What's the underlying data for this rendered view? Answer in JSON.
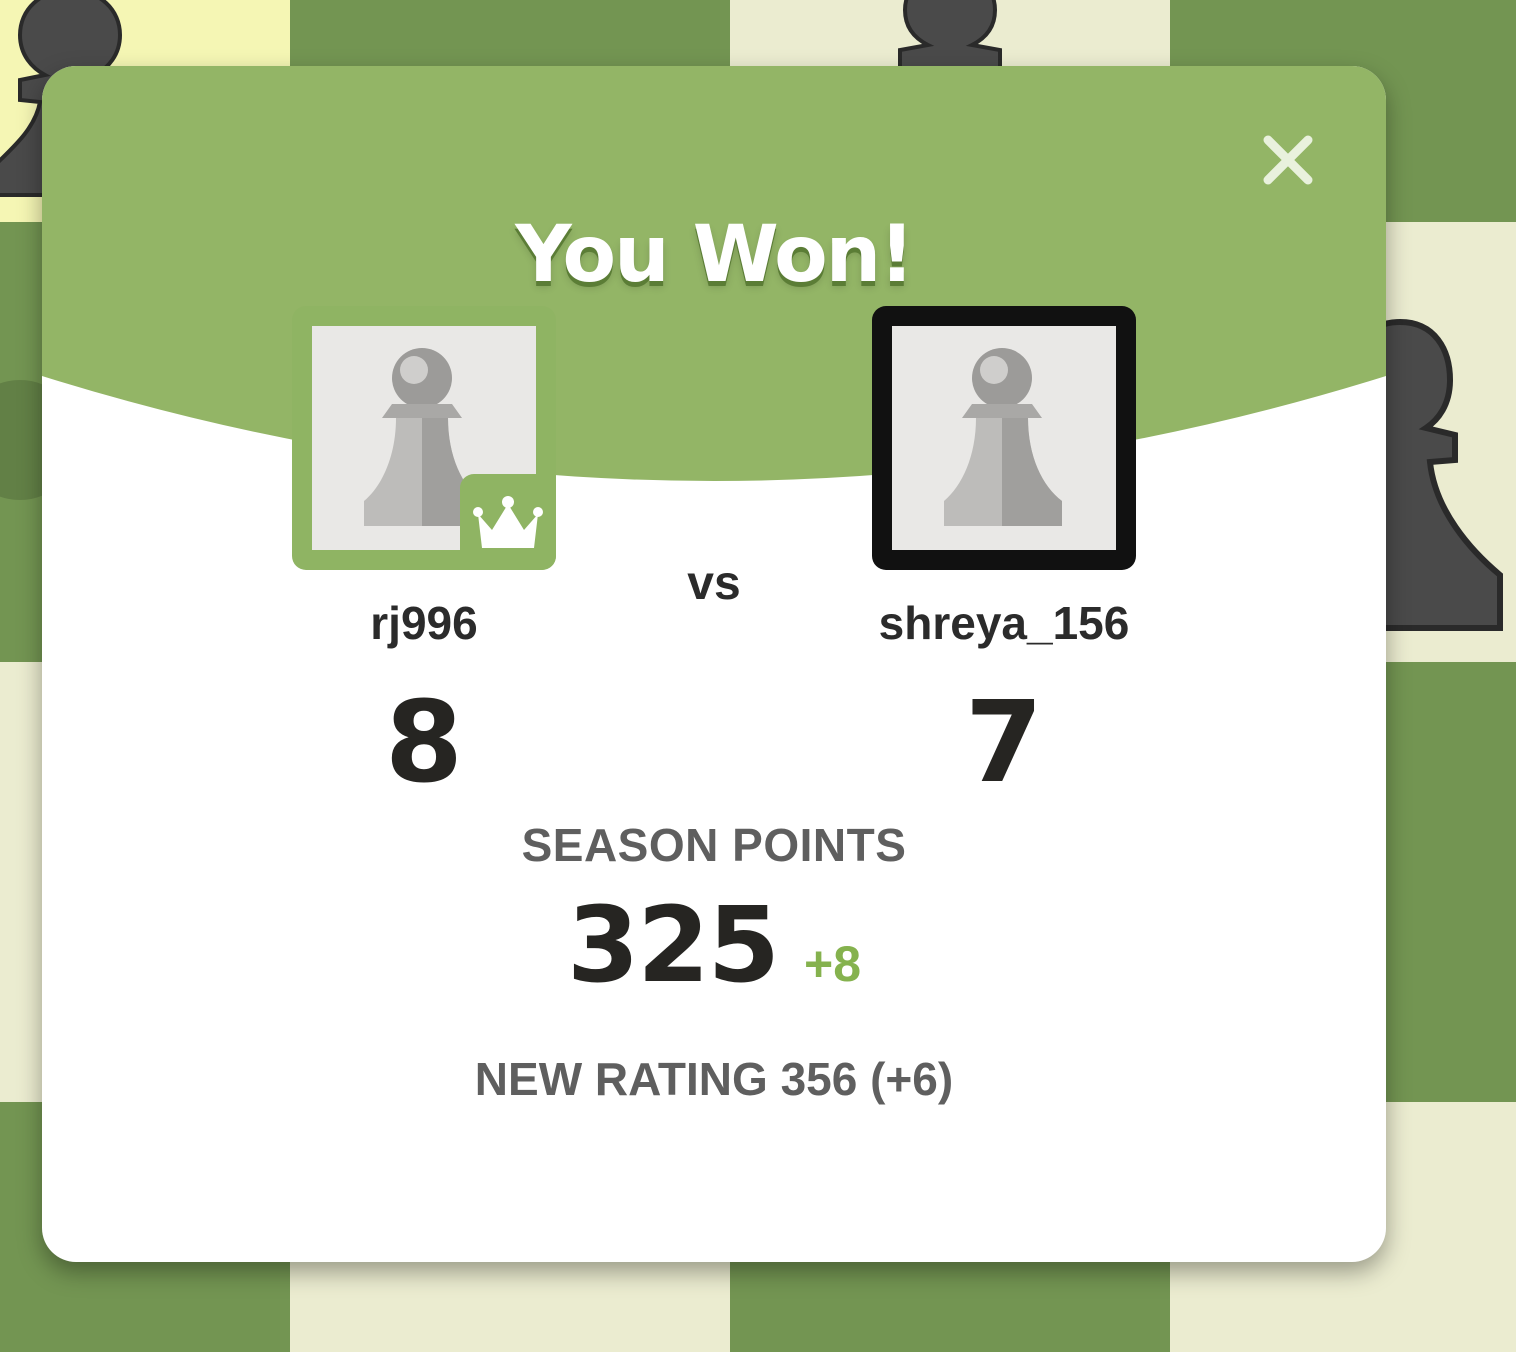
{
  "colors": {
    "board_light": "#ebecd0",
    "board_dark": "#739552",
    "header_green": "#93b566",
    "winner_border": "#8fb463",
    "opponent_border": "#111111",
    "positive_delta": "#85b24e"
  },
  "dialog": {
    "title": "You Won!",
    "close_icon": "close-icon"
  },
  "players": {
    "left": {
      "username": "rj996",
      "score": "8",
      "avatar_icon": "pawn-avatar-icon",
      "badge_icon": "crown-icon"
    },
    "right": {
      "username": "shreya_156",
      "score": "7",
      "avatar_icon": "pawn-avatar-icon"
    }
  },
  "vs_label": "vs",
  "season": {
    "label": "SEASON POINTS",
    "value": "325",
    "delta": "+8"
  },
  "rating": {
    "text": "NEW RATING 356 (+6)"
  }
}
